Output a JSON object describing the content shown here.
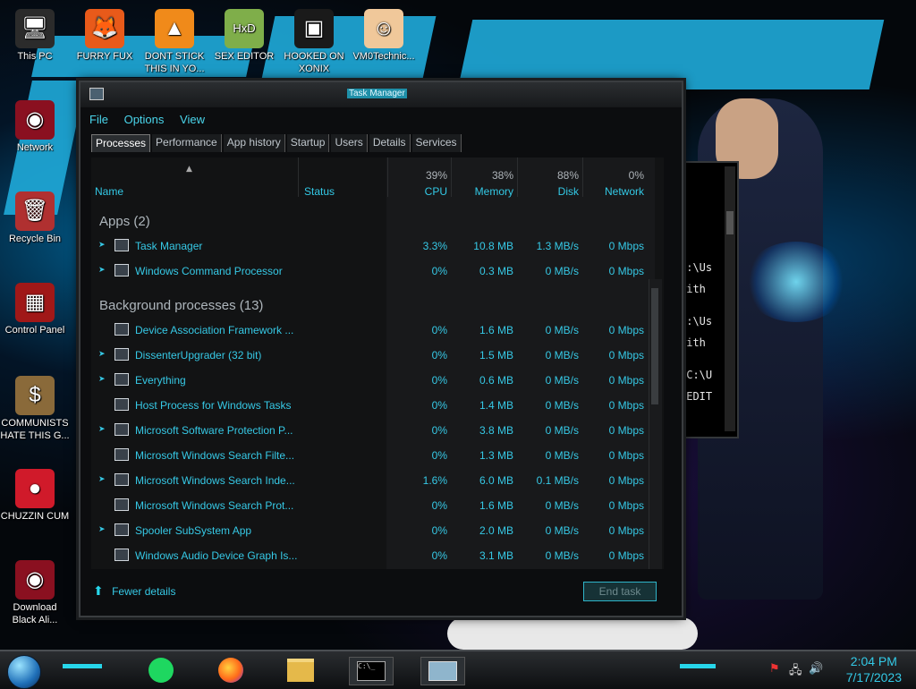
{
  "desktop": {
    "icons": [
      {
        "label": "This PC",
        "name": "this-pc-icon",
        "glyph": "🖥"
      },
      {
        "label": "FURRY FUX",
        "name": "firefox-icon",
        "glyph": "🦊"
      },
      {
        "label": "DONT STICK THIS IN YO...",
        "name": "vlc-icon",
        "glyph": "▲"
      },
      {
        "label": "SEX EDITOR",
        "name": "hxd-icon",
        "glyph": "HxD"
      },
      {
        "label": "HOOKED ON XONIX",
        "name": "xonix-icon",
        "glyph": "▣"
      },
      {
        "label": "VM0Technic...",
        "name": "doctor-icon",
        "glyph": "☺"
      },
      {
        "label": "Network",
        "name": "network-icon",
        "glyph": "◉"
      },
      {
        "label": "Recycle Bin",
        "name": "recycle-bin-icon",
        "glyph": "🗑"
      },
      {
        "label": "Control Panel",
        "name": "control-panel-icon",
        "glyph": "▦"
      },
      {
        "label": "COMMUNISTS HATE THIS G...",
        "name": "money-bag-icon",
        "glyph": "$"
      },
      {
        "label": "CHUZZIN CUM",
        "name": "chuzzle-icon",
        "glyph": "●"
      },
      {
        "label": "Download Black Ali...",
        "name": "download-icon",
        "glyph": "◉"
      }
    ]
  },
  "taskmgr": {
    "title": "Task Manager",
    "menu": [
      "File",
      "Options",
      "View"
    ],
    "tabs": [
      "Processes",
      "Performance",
      "App history",
      "Startup",
      "Users",
      "Details",
      "Services"
    ],
    "columns": {
      "name": "Name",
      "status": "Status",
      "cpu_pct": "39%",
      "cpu": "CPU",
      "mem_pct": "38%",
      "mem": "Memory",
      "disk_pct": "88%",
      "disk": "Disk",
      "net_pct": "0%",
      "net": "Network"
    },
    "apps_group": "Apps (2)",
    "apps": [
      {
        "name": "Task Manager",
        "cpu": "3.3%",
        "mem": "10.8 MB",
        "disk": "1.3 MB/s",
        "net": "0 Mbps",
        "expand": true
      },
      {
        "name": "Windows Command Processor",
        "cpu": "0%",
        "mem": "0.3 MB",
        "disk": "0 MB/s",
        "net": "0 Mbps",
        "expand": true
      }
    ],
    "bg_group": "Background processes (13)",
    "background": [
      {
        "name": "Device Association Framework ...",
        "cpu": "0%",
        "mem": "1.6 MB",
        "disk": "0 MB/s",
        "net": "0 Mbps",
        "expand": false
      },
      {
        "name": "DissenterUpgrader (32 bit)",
        "cpu": "0%",
        "mem": "1.5 MB",
        "disk": "0 MB/s",
        "net": "0 Mbps",
        "expand": true
      },
      {
        "name": "Everything",
        "cpu": "0%",
        "mem": "0.6 MB",
        "disk": "0 MB/s",
        "net": "0 Mbps",
        "expand": true
      },
      {
        "name": "Host Process for Windows Tasks",
        "cpu": "0%",
        "mem": "1.4 MB",
        "disk": "0 MB/s",
        "net": "0 Mbps",
        "expand": false
      },
      {
        "name": "Microsoft Software Protection P...",
        "cpu": "0%",
        "mem": "3.8 MB",
        "disk": "0 MB/s",
        "net": "0 Mbps",
        "expand": true
      },
      {
        "name": "Microsoft Windows Search Filte...",
        "cpu": "0%",
        "mem": "1.3 MB",
        "disk": "0 MB/s",
        "net": "0 Mbps",
        "expand": false
      },
      {
        "name": "Microsoft Windows Search Inde...",
        "cpu": "1.6%",
        "mem": "6.0 MB",
        "disk": "0.1 MB/s",
        "net": "0 Mbps",
        "expand": true
      },
      {
        "name": "Microsoft Windows Search Prot...",
        "cpu": "0%",
        "mem": "1.6 MB",
        "disk": "0 MB/s",
        "net": "0 Mbps",
        "expand": false
      },
      {
        "name": "Spooler SubSystem App",
        "cpu": "0%",
        "mem": "2.0 MB",
        "disk": "0 MB/s",
        "net": "0 Mbps",
        "expand": true
      },
      {
        "name": "Windows Audio Device Graph Is...",
        "cpu": "0%",
        "mem": "3.1 MB",
        "disk": "0 MB/s",
        "net": "0 Mbps",
        "expand": false
      }
    ],
    "fewer_details": "Fewer details",
    "end_task": "End task"
  },
  "cmd": {
    "lines": [
      "C:\\Us",
      " with",
      "C:\\Us",
      " with",
      "\"C:\\U",
      "REDIT"
    ]
  },
  "taskbar": {
    "clock_time": "2:04 PM",
    "clock_date": "7/17/2023"
  },
  "colors": {
    "accent": "#33c9e6",
    "brush": "#1ea7d6"
  }
}
